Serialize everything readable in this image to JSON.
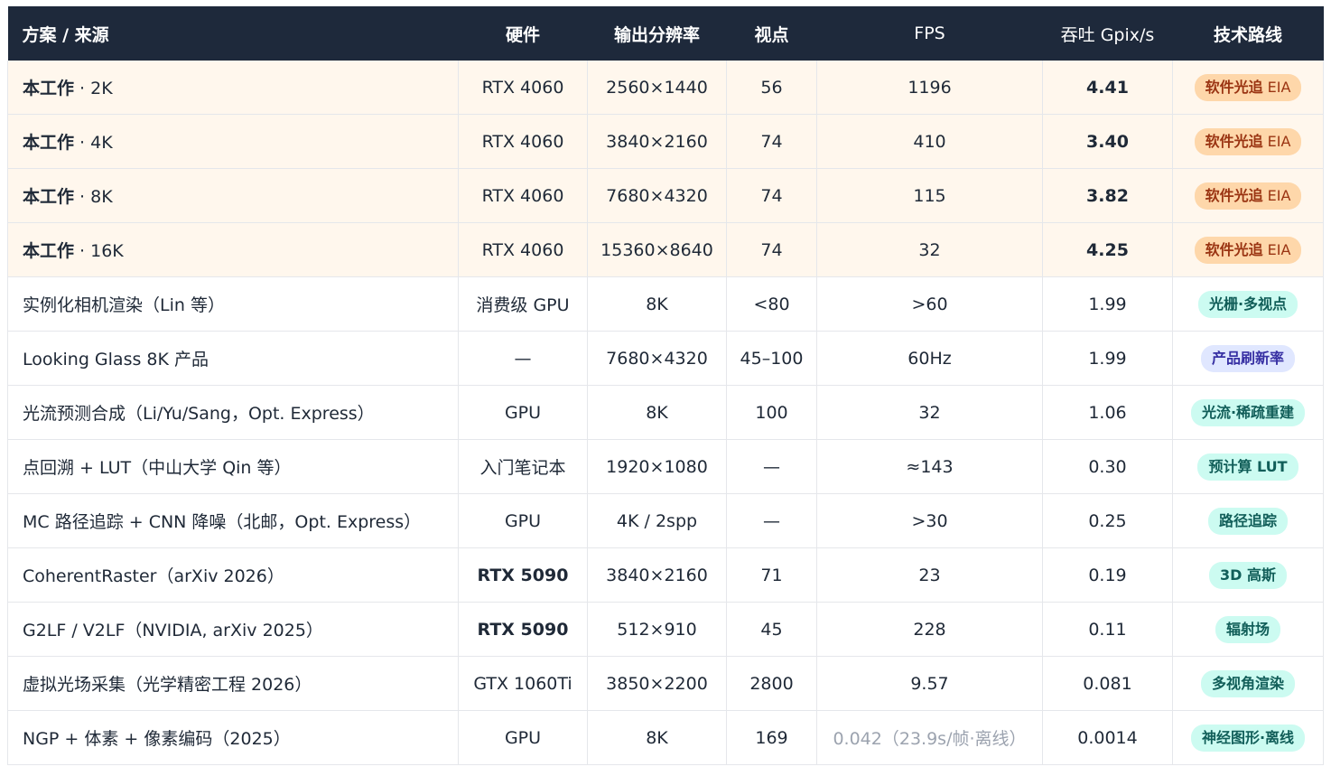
{
  "table": {
    "headers": {
      "name": "方案 / 来源",
      "hardware": "硬件",
      "resolution": "输出分辨率",
      "views": "视点",
      "fps": "FPS",
      "throughput": "吞吐 Gpix/s",
      "route": "技术路线"
    },
    "rows": [
      {
        "name_main": "本工作",
        "name_sep": " · 2K",
        "hardware": "RTX 4060",
        "resolution": "2560×1440",
        "views": "56",
        "fps": "1196",
        "throughput": "4.41",
        "route": "软件光追",
        "route_suffix": " EIA"
      },
      {
        "name_main": "本工作",
        "name_sep": " · 4K",
        "hardware": "RTX 4060",
        "resolution": "3840×2160",
        "views": "74",
        "fps": "410",
        "throughput": "3.40",
        "route": "软件光追",
        "route_suffix": " EIA"
      },
      {
        "name_main": "本工作",
        "name_sep": " · 8K",
        "hardware": "RTX 4060",
        "resolution": "7680×4320",
        "views": "74",
        "fps": "115",
        "throughput": "3.82",
        "route": "软件光追",
        "route_suffix": " EIA"
      },
      {
        "name_main": "本工作",
        "name_sep": " · 16K",
        "hardware": "RTX 4060",
        "resolution": "15360×8640",
        "views": "74",
        "fps": "32",
        "throughput": "4.25",
        "route": "软件光追",
        "route_suffix": " EIA"
      },
      {
        "name": "实例化相机渲染（Lin 等）",
        "hardware": "消费级 GPU",
        "resolution": "8K",
        "views": "<80",
        "fps": ">60",
        "throughput": "1.99",
        "route": "光栅·多视点"
      },
      {
        "name": "Looking Glass 8K 产品",
        "hardware": "—",
        "resolution": "7680×4320",
        "views": "45–100",
        "fps": "60Hz",
        "throughput": "1.99",
        "route": "产品刷新率"
      },
      {
        "name": "光流预测合成（Li/Yu/Sang，Opt. Express）",
        "hardware": "GPU",
        "resolution": "8K",
        "views": "100",
        "fps": "32",
        "throughput": "1.06",
        "route": "光流·稀疏重建"
      },
      {
        "name": "点回溯 + LUT（中山大学 Qin 等）",
        "hardware": "入门笔记本",
        "resolution": "1920×1080",
        "views": "—",
        "fps": "≈143",
        "throughput": "0.30",
        "route": "预计算 LUT"
      },
      {
        "name": "MC 路径追踪 + CNN 降噪（北邮，Opt. Express）",
        "hardware": "GPU",
        "resolution": "4K / 2spp",
        "views": "—",
        "fps": ">30",
        "throughput": "0.25",
        "route": "路径追踪"
      },
      {
        "name": "CoherentRaster（arXiv 2026）",
        "hardware": "RTX 5090",
        "resolution": "3840×2160",
        "views": "71",
        "fps": "23",
        "throughput": "0.19",
        "route": "3D 高斯"
      },
      {
        "name": "G2LF / V2LF（NVIDIA, arXiv 2025）",
        "hardware": "RTX 5090",
        "resolution": "512×910",
        "views": "45",
        "fps": "228",
        "throughput": "0.11",
        "route": "辐射场"
      },
      {
        "name": "虚拟光场采集（光学精密工程 2026）",
        "hardware": "GTX 1060Ti",
        "resolution": "3850×2200",
        "views": "2800",
        "fps": "9.57",
        "throughput": "0.081",
        "route": "多视角渲染"
      },
      {
        "name": "NGP + 体素 + 像素编码（2025）",
        "hardware": "GPU",
        "resolution": "8K",
        "views": "169",
        "fps": "0.042（23.9s/帧·离线）",
        "throughput": "0.0014",
        "route": "神经图形·离线"
      }
    ]
  },
  "colors": {
    "header_bg": "#1e293b",
    "ours_row_bg": "#fff7ed",
    "badge_orange_bg": "#fed7aa",
    "badge_orange_text": "#9a3412",
    "badge_teal_bg": "#ccfbf1",
    "badge_teal_text": "#115e59",
    "badge_purple_bg": "#e0e7ff",
    "badge_purple_text": "#3730a3"
  }
}
